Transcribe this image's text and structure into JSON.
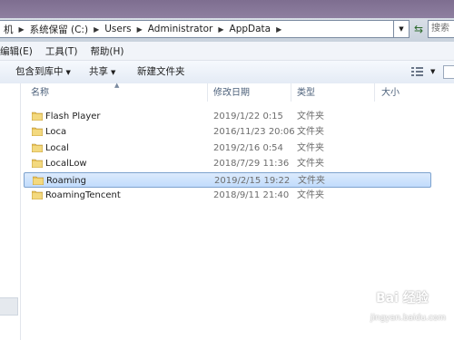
{
  "address": {
    "crumbs": [
      "机",
      "系统保留 (C:)",
      "Users",
      "Administrator",
      "AppData"
    ],
    "search_placeholder": "搜索"
  },
  "menu": [
    "编辑(E)",
    "工具(T)",
    "帮助(H)"
  ],
  "toolbar": {
    "include_library": "包含到库中",
    "share": "共享",
    "new_folder": "新建文件夹"
  },
  "columns": {
    "name": "名称",
    "date": "修改日期",
    "type": "类型",
    "size": "大小"
  },
  "files": [
    {
      "name": "Flash Player",
      "date": "2019/1/22 0:15",
      "type": "文件夹"
    },
    {
      "name": "Loca",
      "date": "2016/11/23 20:06",
      "type": "文件夹"
    },
    {
      "name": "Local",
      "date": "2019/2/16 0:54",
      "type": "文件夹"
    },
    {
      "name": "LocalLow",
      "date": "2018/7/29 11:36",
      "type": "文件夹"
    },
    {
      "name": "Roaming",
      "date": "2019/2/15 19:22",
      "type": "文件夹"
    },
    {
      "name": "RoamingTencent",
      "date": "2018/9/11 21:40",
      "type": "文件夹"
    }
  ],
  "selected_index": 4,
  "watermark": {
    "logo": "Bai 经验",
    "url": "jingyan.baidu.com"
  },
  "colors": {
    "selection": "#c1dcfc",
    "folder": "#e8c25a"
  }
}
